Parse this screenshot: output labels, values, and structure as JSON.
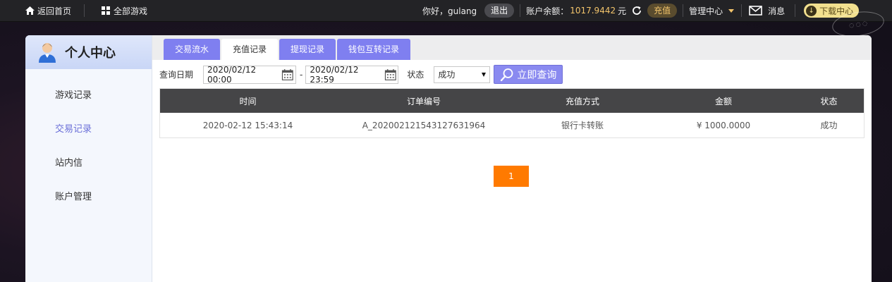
{
  "topbar": {
    "home_label": "返回首页",
    "all_games_label": "全部游戏",
    "greeting": "你好，gulang",
    "logout_label": "退出",
    "balance_label": "账户余额：",
    "balance_value": "1017.9442",
    "currency_unit": "元",
    "recharge_label": "充值",
    "management_label": "管理中心",
    "messages_label": "消息",
    "download_label": "下载中心",
    "accent_color": "#f2c46b"
  },
  "sidebar": {
    "title": "个人中心",
    "items": [
      {
        "label": "游戏记录",
        "active": false
      },
      {
        "label": "交易记录",
        "active": true
      },
      {
        "label": "站内信",
        "active": false
      },
      {
        "label": "账户管理",
        "active": false
      }
    ]
  },
  "tabs": [
    {
      "label": "交易流水",
      "active": false
    },
    {
      "label": "充值记录",
      "active": true
    },
    {
      "label": "提现记录",
      "active": false
    },
    {
      "label": "钱包互转记录",
      "active": false
    }
  ],
  "filter": {
    "date_label": "查询日期",
    "start_date": "2020/02/12 00:00",
    "separator": "-",
    "end_date": "2020/02/12 23:59",
    "status_label": "状态",
    "status_value": "成功",
    "query_button": "立即查询"
  },
  "table": {
    "headers": [
      "时间",
      "订单编号",
      "充值方式",
      "金额",
      "状态"
    ],
    "rows": [
      [
        "2020-02-12 15:43:14",
        "A_202002121543127631964",
        "银行卡转账",
        "¥ 1000.0000",
        "成功"
      ]
    ]
  },
  "pagination": {
    "current_page": "1",
    "active_color": "#ff7a00"
  },
  "tab_color": "#7f7ff0"
}
